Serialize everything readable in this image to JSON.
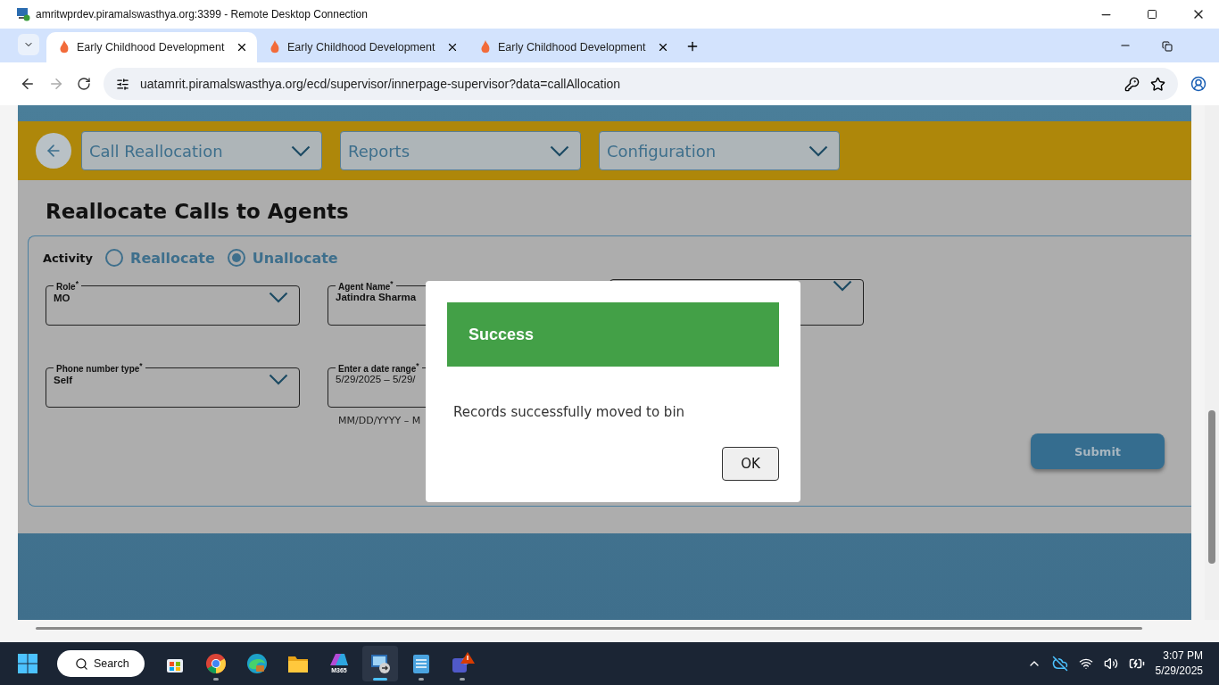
{
  "rdp_window": {
    "title": "amritwprdev.piramalswasthya.org:3399 - Remote Desktop Connection"
  },
  "browser": {
    "tabs": [
      {
        "label": "Early Childhood Development",
        "selected": true
      },
      {
        "label": "Early Childhood Development",
        "selected": false
      },
      {
        "label": "Early Childhood Development",
        "selected": false
      }
    ],
    "url": "uatamrit.piramalswasthya.org/ecd/supervisor/innerpage-supervisor?data=callAllocation"
  },
  "page": {
    "menus": [
      {
        "label": "Call Reallocation"
      },
      {
        "label": "Reports"
      },
      {
        "label": "Configuration"
      }
    ],
    "heading": "Reallocate Calls to Agents",
    "activity": {
      "label": "Activity",
      "options": [
        {
          "label": "Reallocate",
          "selected": false
        },
        {
          "label": "Unallocate",
          "selected": true
        }
      ]
    },
    "field_rows": [
      [
        {
          "label": "Role$^{*}$",
          "value": "MO",
          "chevron": true
        },
        {
          "label": "Agent Name$^{*}$",
          "value": "Jatindra Sharma",
          "chevron": false
        },
        {
          "chevron": true
        }
      ],
      [
        {
          "label": "Phone number type$^{*}$",
          "value": "Self",
          "chevron": true
        },
        {
          "kind": "date",
          "label": "Enter a date range$^{*}$",
          "value": "5/29/2025 – 5/29/",
          "hint": "MM/DD/YYYY – M",
          "chevron": false
        }
      ]
    ],
    "submit": "Submit"
  },
  "dialog": {
    "title": "Success",
    "message": "Records successfully moved to bin",
    "ok": "OK"
  },
  "taskbar": {
    "search": "Search",
    "apps": [
      {
        "kind": "store",
        "running": false,
        "selected": false
      },
      {
        "kind": "chrome",
        "running": true,
        "selected": false
      },
      {
        "kind": "edge",
        "running": false,
        "selected": false
      },
      {
        "kind": "folder",
        "running": false,
        "selected": false
      },
      {
        "kind": "m365",
        "label": "M365",
        "running": false,
        "selected": false
      },
      {
        "kind": "rdp",
        "running": true,
        "selected": true
      },
      {
        "kind": "notepad",
        "running": true,
        "selected": false
      },
      {
        "kind": "teams",
        "running": true,
        "selected": false
      }
    ],
    "time": "3:07 PM",
    "date": "5/29/2025"
  }
}
